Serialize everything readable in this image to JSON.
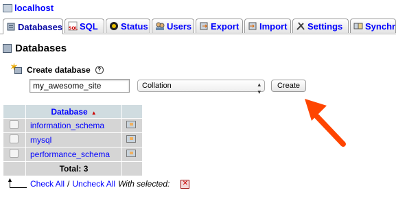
{
  "breadcrumb": {
    "server": "localhost"
  },
  "tabs": [
    {
      "label": "Databases",
      "icon": "database-icon",
      "active": true
    },
    {
      "label": "SQL",
      "icon": "sql-icon"
    },
    {
      "label": "Status",
      "icon": "status-icon"
    },
    {
      "label": "Users",
      "icon": "users-icon"
    },
    {
      "label": "Export",
      "icon": "export-icon"
    },
    {
      "label": "Import",
      "icon": "import-icon"
    },
    {
      "label": "Settings",
      "icon": "settings-icon"
    },
    {
      "label": "Synchr",
      "icon": "synchronize-icon"
    }
  ],
  "page": {
    "title": "Databases"
  },
  "create": {
    "label": "Create database",
    "help": "?",
    "db_name_value": "my_awesome_site",
    "collation_value": "Collation",
    "button": "Create"
  },
  "table": {
    "header": "Database",
    "rows": [
      {
        "name": "information_schema"
      },
      {
        "name": "mysql"
      },
      {
        "name": "performance_schema"
      }
    ],
    "total": "Total: 3"
  },
  "footer": {
    "check_all": "Check All",
    "separator": "/",
    "uncheck_all": "Uncheck All",
    "with_selected": "With selected:"
  },
  "colors": {
    "link": "#0000ff",
    "accent_arrow": "#ff4500",
    "header_bg": "#d0dce0",
    "row_bg": "#d5d5d5"
  }
}
